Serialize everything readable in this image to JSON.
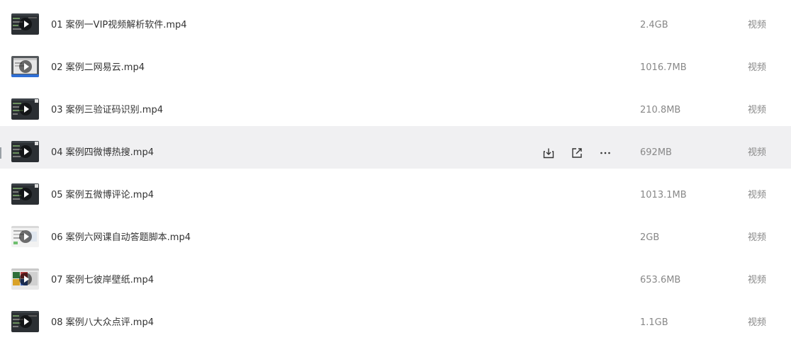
{
  "files": [
    {
      "name": "01 案例一VIP视频解析软件.mp4",
      "size": "2.4GB",
      "type": "视频",
      "thumb": "dark-editor"
    },
    {
      "name": "02 案例二网易云.mp4",
      "size": "1016.7MB",
      "type": "视频",
      "thumb": "grey-window"
    },
    {
      "name": "03 案例三验证码识别.mp4",
      "size": "210.8MB",
      "type": "视频",
      "thumb": "dark-editor"
    },
    {
      "name": "04 案例四微博热搜.mp4",
      "size": "692MB",
      "type": "视频",
      "thumb": "dark-editor"
    },
    {
      "name": "05 案例五微博评论.mp4",
      "size": "1013.1MB",
      "type": "视频",
      "thumb": "dark-editor"
    },
    {
      "name": "06 案例六网课自动答题脚本.mp4",
      "size": "2GB",
      "type": "视频",
      "thumb": "light-page"
    },
    {
      "name": "07 案例七彼岸壁纸.mp4",
      "size": "653.6MB",
      "type": "视频",
      "thumb": "colorful-page"
    },
    {
      "name": "08 案例八大众点评.mp4",
      "size": "1.1GB",
      "type": "视频",
      "thumb": "dark-editor"
    }
  ],
  "hovered_row": 3,
  "hover_actions": [
    {
      "icon": "download-icon",
      "label": "download"
    },
    {
      "icon": "share-icon",
      "label": "share"
    },
    {
      "icon": "more-icon",
      "label": "more"
    }
  ],
  "colors": {
    "row_hover_bg": "#f0f0f2",
    "name_text": "#333333",
    "meta_text": "#888888",
    "icon": "#333333"
  }
}
